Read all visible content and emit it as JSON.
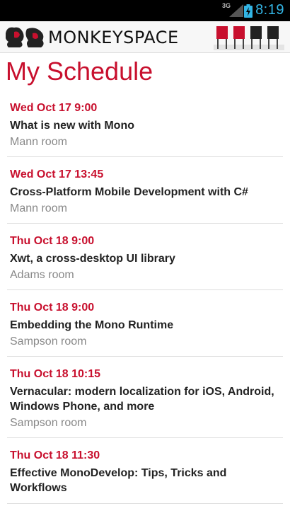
{
  "status_bar": {
    "network": "3G",
    "time": "8:19",
    "icons": [
      "signal-icon",
      "battery-icon"
    ]
  },
  "app_bar": {
    "brand": "MONKEYSPACE",
    "icons": [
      "monkey-logo-icon",
      "chairs-illustration"
    ]
  },
  "page": {
    "title": "My Schedule"
  },
  "sessions": [
    {
      "time": "Wed Oct 17 9:00",
      "title": "What is new with Mono",
      "room": "Mann room"
    },
    {
      "time": "Wed Oct 17 13:45",
      "title": "Cross-Platform Mobile Development with C#",
      "room": "Mann room"
    },
    {
      "time": "Thu Oct 18 9:00",
      "title": "Xwt, a cross-desktop UI library",
      "room": "Adams room"
    },
    {
      "time": "Thu Oct 18 9:00",
      "title": "Embedding the Mono Runtime",
      "room": "Sampson room"
    },
    {
      "time": "Thu Oct 18 10:15",
      "title": "Vernacular: modern localization for iOS, Android, Windows Phone, and more",
      "room": "Sampson room"
    },
    {
      "time": "Thu Oct 18 11:30",
      "title": "Effective MonoDevelop: Tips, Tricks and Workflows",
      "room": ""
    }
  ],
  "colors": {
    "accent": "#c8102e",
    "status_bar_bg": "#000000",
    "clock": "#33b5e5",
    "room_text": "#888888"
  }
}
